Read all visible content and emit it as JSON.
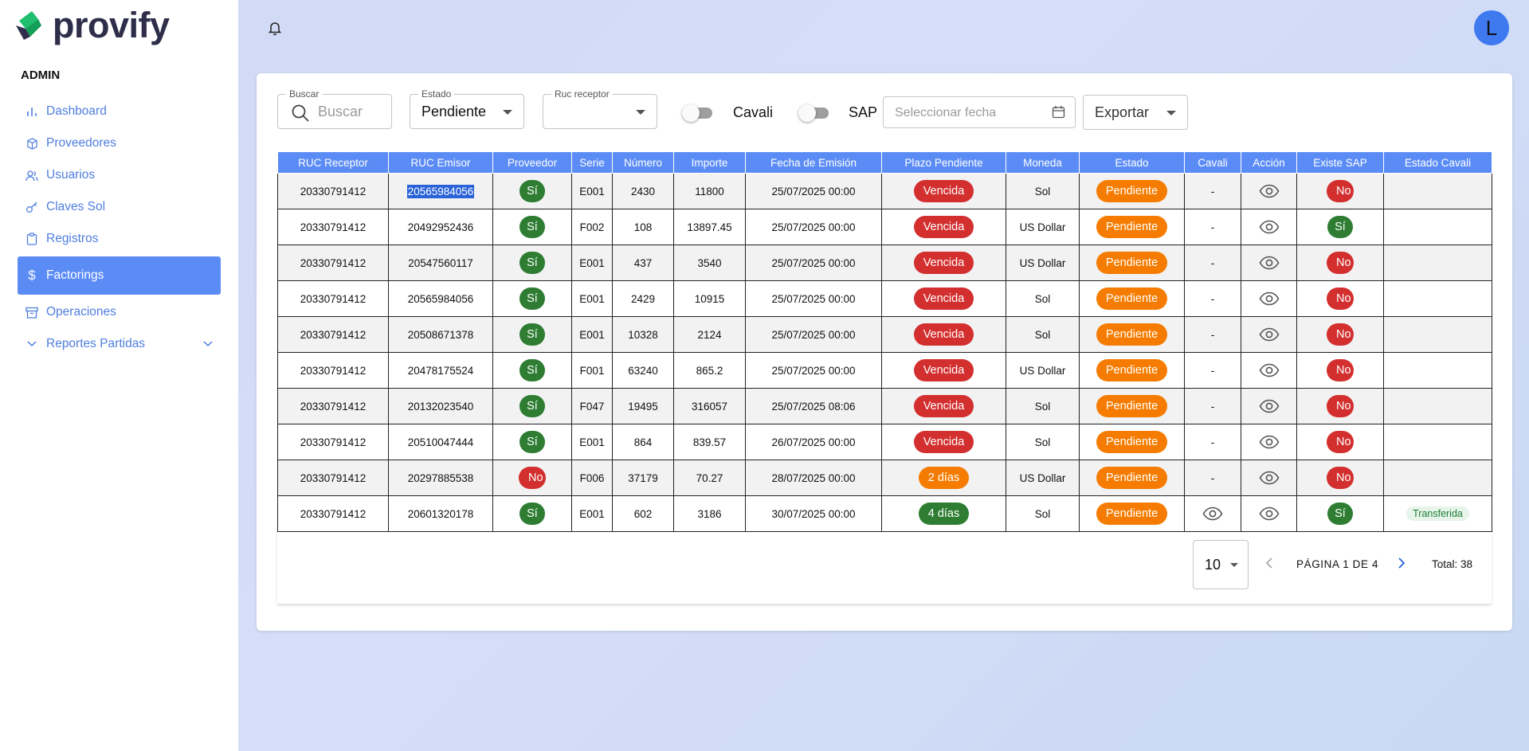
{
  "brand": {
    "name": "provify"
  },
  "sidebar": {
    "role": "ADMIN",
    "items": [
      {
        "label": "Dashboard",
        "icon": "bar-chart-icon"
      },
      {
        "label": "Proveedores",
        "icon": "package-icon"
      },
      {
        "label": "Usuarios",
        "icon": "users-icon"
      },
      {
        "label": "Claves Sol",
        "icon": "key-icon"
      },
      {
        "label": "Registros",
        "icon": "clipboard-icon"
      },
      {
        "label": "Factorings",
        "icon": "dollar-icon",
        "active": true
      },
      {
        "label": "Operaciones",
        "icon": "archive-icon"
      },
      {
        "label": "Reportes Partidas",
        "icon": "chevron-down-icon"
      }
    ]
  },
  "user": {
    "initial": "L"
  },
  "filters": {
    "buscar_label": "Buscar",
    "buscar_placeholder": "Buscar",
    "estado_label": "Estado",
    "estado_value": "Pendiente",
    "ruc_label": "Ruc receptor",
    "ruc_value": "",
    "cavali_label": "Cavali",
    "sap_label": "SAP",
    "fecha_placeholder": "Seleccionar fecha",
    "exportar_label": "Exportar"
  },
  "table": {
    "columns": [
      "RUC Receptor",
      "RUC Emisor",
      "Proveedor",
      "Serie",
      "Número",
      "Importe",
      "Fecha de Emisión",
      "Plazo Pendiente",
      "Moneda",
      "Estado",
      "Cavali",
      "Acción",
      "Existe SAP",
      "Estado Cavali"
    ],
    "rows": [
      {
        "ruc_receptor": "20330791412",
        "ruc_emisor": "20565984056",
        "proveedor": "Sí",
        "serie": "E001",
        "numero": "2430",
        "importe": "11800",
        "fecha": "25/07/2025 00:00",
        "plazo": "Vencida",
        "moneda": "Sol",
        "estado": "Pendiente",
        "cavali": "-",
        "existe_sap": "No",
        "estado_cavali": ""
      },
      {
        "ruc_receptor": "20330791412",
        "ruc_emisor": "20492952436",
        "proveedor": "Sí",
        "serie": "F002",
        "numero": "108",
        "importe": "13897.45",
        "fecha": "25/07/2025 00:00",
        "plazo": "Vencida",
        "moneda": "US Dollar",
        "estado": "Pendiente",
        "cavali": "-",
        "existe_sap": "Sí",
        "estado_cavali": ""
      },
      {
        "ruc_receptor": "20330791412",
        "ruc_emisor": "20547560117",
        "proveedor": "Sí",
        "serie": "E001",
        "numero": "437",
        "importe": "3540",
        "fecha": "25/07/2025 00:00",
        "plazo": "Vencida",
        "moneda": "US Dollar",
        "estado": "Pendiente",
        "cavali": "-",
        "existe_sap": "No",
        "estado_cavali": ""
      },
      {
        "ruc_receptor": "20330791412",
        "ruc_emisor": "20565984056",
        "proveedor": "Sí",
        "serie": "E001",
        "numero": "2429",
        "importe": "10915",
        "fecha": "25/07/2025 00:00",
        "plazo": "Vencida",
        "moneda": "Sol",
        "estado": "Pendiente",
        "cavali": "-",
        "existe_sap": "No",
        "estado_cavali": ""
      },
      {
        "ruc_receptor": "20330791412",
        "ruc_emisor": "20508671378",
        "proveedor": "Sí",
        "serie": "E001",
        "numero": "10328",
        "importe": "2124",
        "fecha": "25/07/2025 00:00",
        "plazo": "Vencida",
        "moneda": "Sol",
        "estado": "Pendiente",
        "cavali": "-",
        "existe_sap": "No",
        "estado_cavali": ""
      },
      {
        "ruc_receptor": "20330791412",
        "ruc_emisor": "20478175524",
        "proveedor": "Sí",
        "serie": "F001",
        "numero": "63240",
        "importe": "865.2",
        "fecha": "25/07/2025 00:00",
        "plazo": "Vencida",
        "moneda": "US Dollar",
        "estado": "Pendiente",
        "cavali": "-",
        "existe_sap": "No",
        "estado_cavali": ""
      },
      {
        "ruc_receptor": "20330791412",
        "ruc_emisor": "20132023540",
        "proveedor": "Sí",
        "serie": "F047",
        "numero": "19495",
        "importe": "316057",
        "fecha": "25/07/2025 08:06",
        "plazo": "Vencida",
        "moneda": "Sol",
        "estado": "Pendiente",
        "cavali": "-",
        "existe_sap": "No",
        "estado_cavali": ""
      },
      {
        "ruc_receptor": "20330791412",
        "ruc_emisor": "20510047444",
        "proveedor": "Sí",
        "serie": "E001",
        "numero": "864",
        "importe": "839.57",
        "fecha": "26/07/2025 00:00",
        "plazo": "Vencida",
        "moneda": "Sol",
        "estado": "Pendiente",
        "cavali": "-",
        "existe_sap": "No",
        "estado_cavali": ""
      },
      {
        "ruc_receptor": "20330791412",
        "ruc_emisor": "20297885538",
        "proveedor": "No",
        "serie": "F006",
        "numero": "37179",
        "importe": "70.27",
        "fecha": "28/07/2025 00:00",
        "plazo": "2 días",
        "moneda": "US Dollar",
        "estado": "Pendiente",
        "cavali": "-",
        "existe_sap": "No",
        "estado_cavali": ""
      },
      {
        "ruc_receptor": "20330791412",
        "ruc_emisor": "20601320178",
        "proveedor": "Sí",
        "serie": "E001",
        "numero": "602",
        "importe": "3186",
        "fecha": "30/07/2025 00:00",
        "plazo": "4 días",
        "moneda": "Sol",
        "estado": "Pendiente",
        "cavali": "eye",
        "existe_sap": "Sí",
        "estado_cavali": "Transferida"
      }
    ]
  },
  "pagination": {
    "rows_per_page": "10",
    "page_label": "PÁGINA 1 DE 4",
    "total_label": "Total: 38"
  },
  "colors": {
    "accent": "#5b8cf6",
    "danger": "#d32f2f",
    "success": "#2e7d32",
    "warning": "#f57c00"
  }
}
